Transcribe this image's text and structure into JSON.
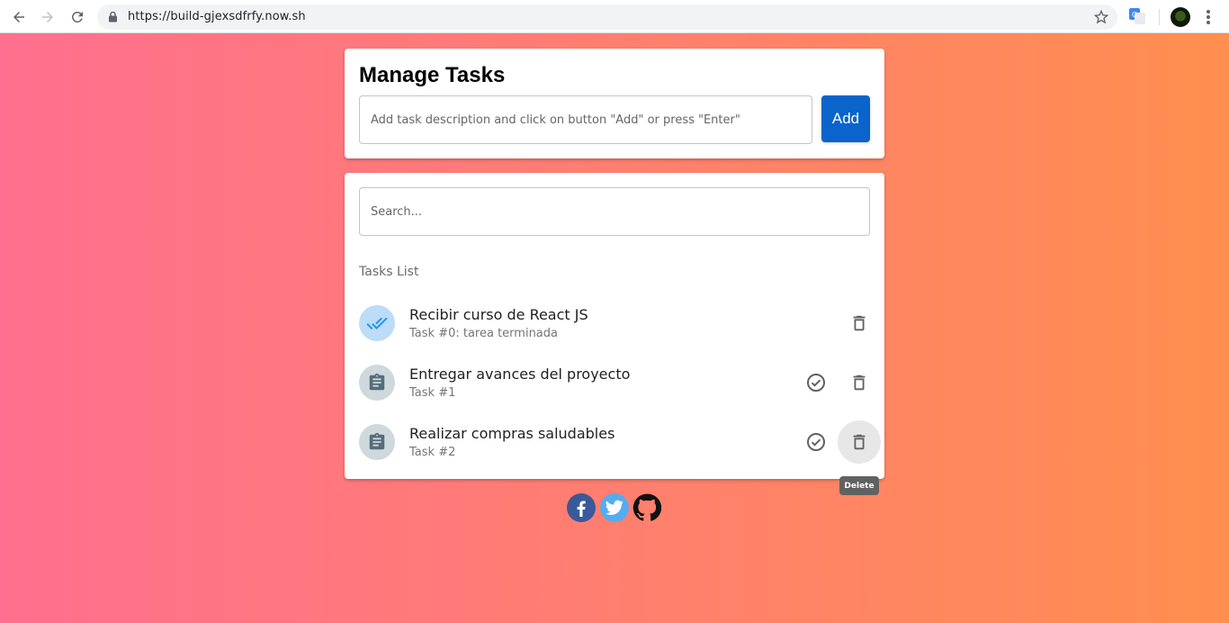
{
  "browser": {
    "url": "https://build-gjexsdfrfy.now.sh"
  },
  "add_card": {
    "title": "Manage Tasks",
    "input_placeholder": "Add task description and click on button \"Add\" or press \"Enter\"",
    "add_button_label": "Add"
  },
  "list_card": {
    "search_placeholder": "Search...",
    "header": "Tasks List",
    "tasks": [
      {
        "title": "Recibir curso de React JS",
        "subtitle": "Task #0: tarea terminada",
        "done": true
      },
      {
        "title": "Entregar avances del proyecto",
        "subtitle": "Task #1",
        "done": false
      },
      {
        "title": "Realizar compras saludables",
        "subtitle": "Task #2",
        "done": false
      }
    ]
  },
  "tooltip": {
    "label": "Delete"
  },
  "social": {
    "icons": [
      "facebook-icon",
      "twitter-icon",
      "github-icon"
    ]
  },
  "colors": {
    "accent": "#0a64cc",
    "background_left": "#ff6f8f",
    "background_right": "#ff8f4f"
  }
}
